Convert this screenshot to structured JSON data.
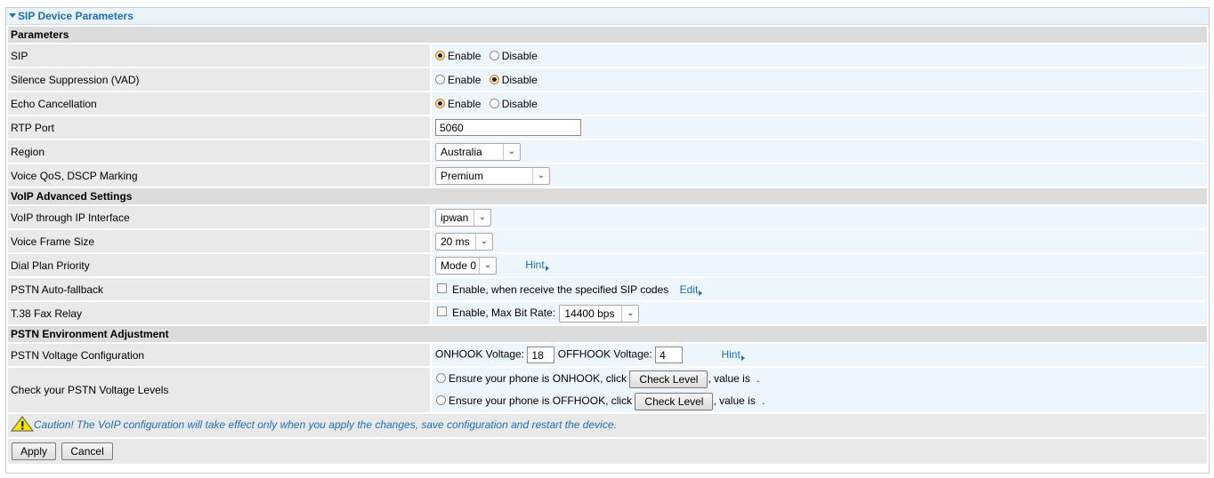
{
  "panel": {
    "title": "SIP Device Parameters"
  },
  "sections": {
    "parameters": "Parameters",
    "voip_advanced": "VoIP Advanced Settings",
    "pstn_env": "PSTN Environment Adjustment"
  },
  "rows": {
    "sip": {
      "label": "SIP",
      "enable": "Enable",
      "disable": "Disable",
      "selected": "Enable"
    },
    "vad": {
      "label": "Silence Suppression (VAD)",
      "enable": "Enable",
      "disable": "Disable",
      "selected": "Disable"
    },
    "echo": {
      "label": "Echo Cancellation",
      "enable": "Enable",
      "disable": "Disable",
      "selected": "Enable"
    },
    "rtp_port": {
      "label": "RTP Port",
      "value": "5060"
    },
    "region": {
      "label": "Region",
      "value": "Australia"
    },
    "qos": {
      "label": "Voice QoS, DSCP Marking",
      "value": "Premium"
    },
    "ip_interface": {
      "label": "VoIP through IP Interface",
      "value": "ipwan"
    },
    "frame_size": {
      "label": "Voice Frame Size",
      "value": "20 ms"
    },
    "dial_plan": {
      "label": "Dial Plan Priority",
      "value": "Mode 0",
      "hint": "Hint"
    },
    "pstn_fallback": {
      "label": "PSTN Auto-fallback",
      "text": "Enable, when receive the specified SIP codes",
      "edit": "Edit",
      "checked": false
    },
    "t38": {
      "label": "T.38 Fax Relay",
      "text": "Enable, Max Bit Rate:",
      "rate": "14400 bps",
      "checked": false
    },
    "voltage_config": {
      "label": "PSTN Voltage Configuration",
      "onhook_label": "ONHOOK Voltage:",
      "onhook_value": "18",
      "offhook_label": "OFFHOOK Voltage:",
      "offhook_value": "4",
      "hint": "Hint"
    },
    "voltage_check": {
      "label": "Check your PSTN Voltage Levels",
      "onhook_text": "Ensure your phone is ONHOOK, click",
      "offhook_text": "Ensure your phone is OFFHOOK, click",
      "button": "Check Level",
      "value_text": ", value is",
      "dot": "."
    }
  },
  "caution": "Caution! The VoIP configuration will take effect only when you apply the changes, save configuration and restart the device.",
  "buttons": {
    "apply": "Apply",
    "cancel": "Cancel"
  },
  "colors": {
    "accent": "#1d6fb8",
    "section_bg": "#dcdcdc",
    "label_bg": "#e9e9e9",
    "value_bg": "#eef6fd"
  }
}
